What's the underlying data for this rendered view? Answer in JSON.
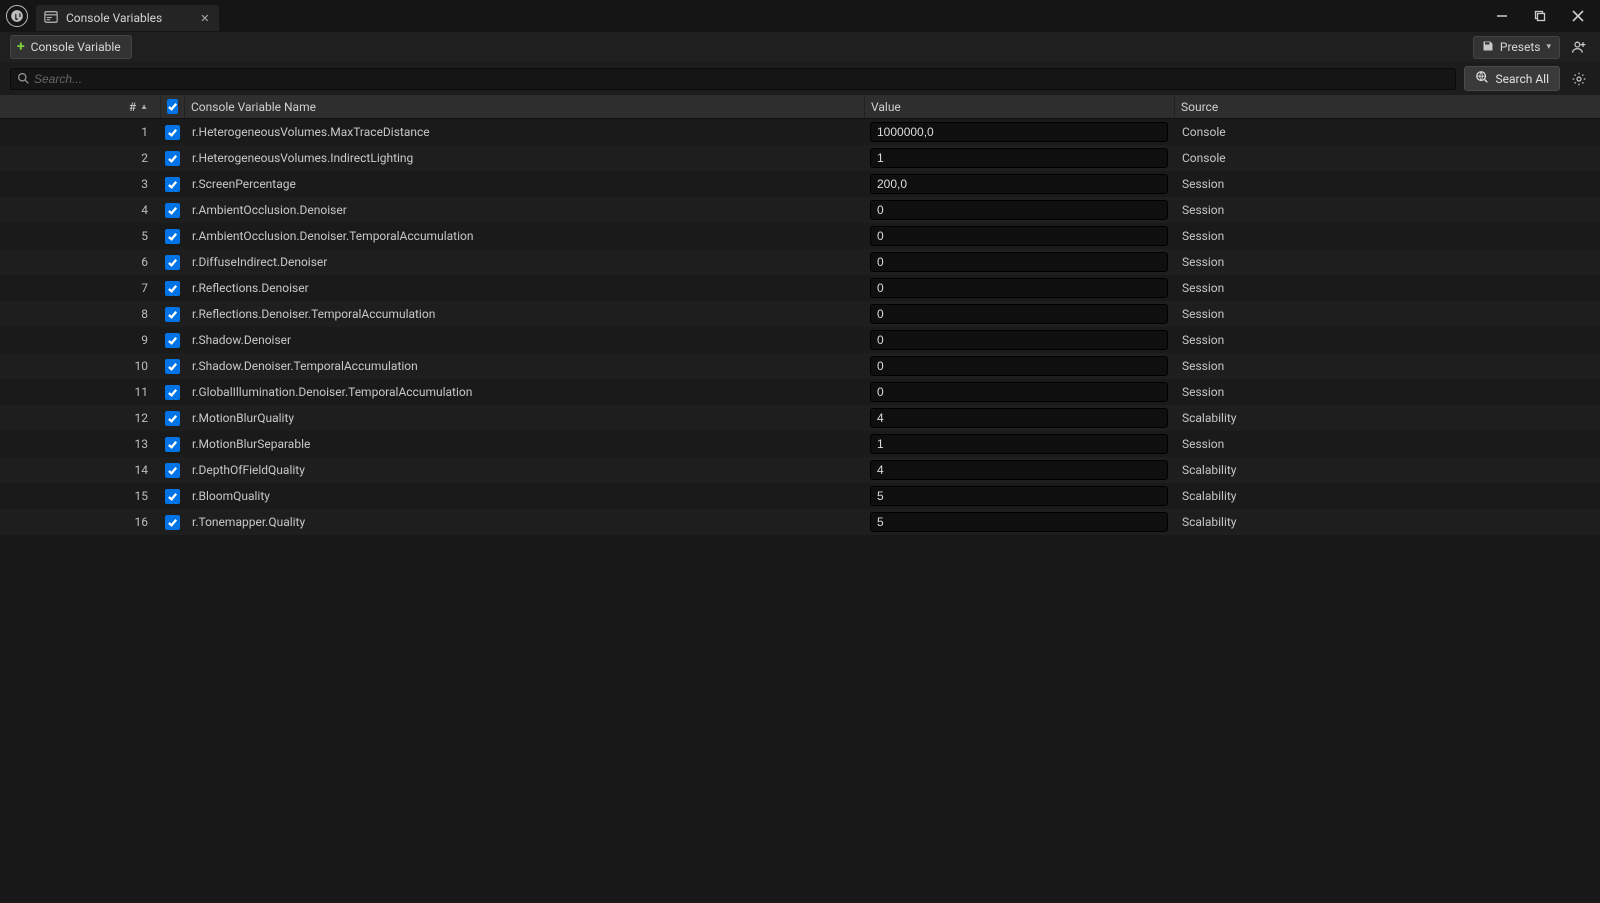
{
  "window": {
    "tab_title": "Console Variables"
  },
  "toolbar": {
    "add_label": "Console Variable",
    "presets_label": "Presets",
    "search_all_label": "Search All"
  },
  "search": {
    "placeholder": "Search..."
  },
  "columns": {
    "index": "#",
    "name": "Console Variable Name",
    "value": "Value",
    "source": "Source"
  },
  "rows": [
    {
      "idx": "1",
      "checked": true,
      "name": "r.HeterogeneousVolumes.MaxTraceDistance",
      "value": "1000000,0",
      "source": "Console"
    },
    {
      "idx": "2",
      "checked": true,
      "name": "r.HeterogeneousVolumes.IndirectLighting",
      "value": "1",
      "source": "Console"
    },
    {
      "idx": "3",
      "checked": true,
      "name": "r.ScreenPercentage",
      "value": "200,0",
      "source": "Session"
    },
    {
      "idx": "4",
      "checked": true,
      "name": "r.AmbientOcclusion.Denoiser",
      "value": "0",
      "source": "Session"
    },
    {
      "idx": "5",
      "checked": true,
      "name": "r.AmbientOcclusion.Denoiser.TemporalAccumulation",
      "value": "0",
      "source": "Session"
    },
    {
      "idx": "6",
      "checked": true,
      "name": "r.DiffuseIndirect.Denoiser",
      "value": "0",
      "source": "Session"
    },
    {
      "idx": "7",
      "checked": true,
      "name": "r.Reflections.Denoiser",
      "value": "0",
      "source": "Session"
    },
    {
      "idx": "8",
      "checked": true,
      "name": "r.Reflections.Denoiser.TemporalAccumulation",
      "value": "0",
      "source": "Session"
    },
    {
      "idx": "9",
      "checked": true,
      "name": "r.Shadow.Denoiser",
      "value": "0",
      "source": "Session"
    },
    {
      "idx": "10",
      "checked": true,
      "name": "r.Shadow.Denoiser.TemporalAccumulation",
      "value": "0",
      "source": "Session"
    },
    {
      "idx": "11",
      "checked": true,
      "name": "r.GlobalIllumination.Denoiser.TemporalAccumulation",
      "value": "0",
      "source": "Session"
    },
    {
      "idx": "12",
      "checked": true,
      "name": "r.MotionBlurQuality",
      "value": "4",
      "source": "Scalability"
    },
    {
      "idx": "13",
      "checked": true,
      "name": "r.MotionBlurSeparable",
      "value": "1",
      "source": "Session"
    },
    {
      "idx": "14",
      "checked": true,
      "name": "r.DepthOfFieldQuality",
      "value": "4",
      "source": "Scalability"
    },
    {
      "idx": "15",
      "checked": true,
      "name": "r.BloomQuality",
      "value": "5",
      "source": "Scalability"
    },
    {
      "idx": "16",
      "checked": true,
      "name": "r.Tonemapper.Quality",
      "value": "5",
      "source": "Scalability"
    }
  ]
}
